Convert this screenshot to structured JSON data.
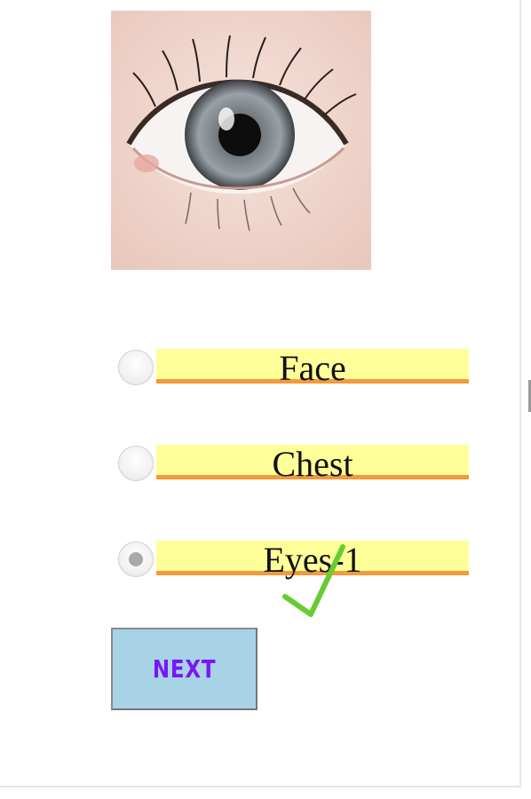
{
  "image": {
    "icon": "eye-photo",
    "alt": "eye"
  },
  "options": [
    {
      "label": "Face",
      "selected": false
    },
    {
      "label": "Chest",
      "selected": false
    },
    {
      "label": "Eyes-1",
      "selected": true,
      "marked_correct": true
    }
  ],
  "next_button": {
    "label": "NEXT"
  },
  "colors": {
    "label_fill": "#ffff99",
    "label_underline": "#f59a3a",
    "check": "#66cc33",
    "button_fill": "#a8d3e6",
    "button_text": "#7a16f5"
  }
}
